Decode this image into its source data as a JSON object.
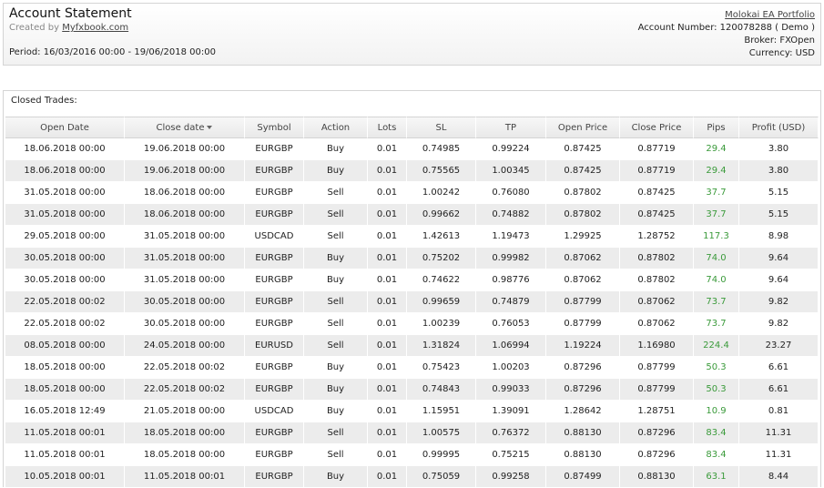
{
  "header": {
    "title": "Account Statement",
    "created_prefix": "Created by",
    "created_link": "Myfxbook.com",
    "period": "Period: 16/03/2016 00:00 - 19/06/2018 00:00",
    "portfolio_link": "Molokai EA Portfolio",
    "account_number": "Account Number: 120078288 ( Demo )",
    "broker": "Broker: FXOpen",
    "currency": "Currency: USD"
  },
  "closed_trades": {
    "label": "Closed Trades:",
    "sorted_column": "close_date",
    "columns": [
      "Open Date",
      "Close date",
      "Symbol",
      "Action",
      "Lots",
      "SL",
      "TP",
      "Open Price",
      "Close Price",
      "Pips",
      "Profit (USD)"
    ],
    "rows": [
      [
        "18.06.2018 00:00",
        "19.06.2018 00:00",
        "EURGBP",
        "Buy",
        "0.01",
        "0.74985",
        "0.99224",
        "0.87425",
        "0.87719",
        "29.4",
        "3.80"
      ],
      [
        "18.06.2018 00:00",
        "19.06.2018 00:00",
        "EURGBP",
        "Buy",
        "0.01",
        "0.75565",
        "1.00345",
        "0.87425",
        "0.87719",
        "29.4",
        "3.80"
      ],
      [
        "31.05.2018 00:00",
        "18.06.2018 00:00",
        "EURGBP",
        "Sell",
        "0.01",
        "1.00242",
        "0.76080",
        "0.87802",
        "0.87425",
        "37.7",
        "5.15"
      ],
      [
        "31.05.2018 00:00",
        "18.06.2018 00:00",
        "EURGBP",
        "Sell",
        "0.01",
        "0.99662",
        "0.74882",
        "0.87802",
        "0.87425",
        "37.7",
        "5.15"
      ],
      [
        "29.05.2018 00:00",
        "31.05.2018 00:00",
        "USDCAD",
        "Sell",
        "0.01",
        "1.42613",
        "1.19473",
        "1.29925",
        "1.28752",
        "117.3",
        "8.98"
      ],
      [
        "30.05.2018 00:00",
        "31.05.2018 00:00",
        "EURGBP",
        "Buy",
        "0.01",
        "0.75202",
        "0.99982",
        "0.87062",
        "0.87802",
        "74.0",
        "9.64"
      ],
      [
        "30.05.2018 00:00",
        "31.05.2018 00:00",
        "EURGBP",
        "Buy",
        "0.01",
        "0.74622",
        "0.98776",
        "0.87062",
        "0.87802",
        "74.0",
        "9.64"
      ],
      [
        "22.05.2018 00:02",
        "30.05.2018 00:00",
        "EURGBP",
        "Sell",
        "0.01",
        "0.99659",
        "0.74879",
        "0.87799",
        "0.87062",
        "73.7",
        "9.82"
      ],
      [
        "22.05.2018 00:02",
        "30.05.2018 00:00",
        "EURGBP",
        "Sell",
        "0.01",
        "1.00239",
        "0.76053",
        "0.87799",
        "0.87062",
        "73.7",
        "9.82"
      ],
      [
        "08.05.2018 00:00",
        "24.05.2018 00:00",
        "EURUSD",
        "Sell",
        "0.01",
        "1.31824",
        "1.06994",
        "1.19224",
        "1.16980",
        "224.4",
        "23.27"
      ],
      [
        "18.05.2018 00:00",
        "22.05.2018 00:02",
        "EURGBP",
        "Buy",
        "0.01",
        "0.75423",
        "1.00203",
        "0.87296",
        "0.87799",
        "50.3",
        "6.61"
      ],
      [
        "18.05.2018 00:00",
        "22.05.2018 00:02",
        "EURGBP",
        "Buy",
        "0.01",
        "0.74843",
        "0.99033",
        "0.87296",
        "0.87799",
        "50.3",
        "6.61"
      ],
      [
        "16.05.2018 12:49",
        "21.05.2018 00:00",
        "USDCAD",
        "Buy",
        "0.01",
        "1.15951",
        "1.39091",
        "1.28642",
        "1.28751",
        "10.9",
        "0.81"
      ],
      [
        "11.05.2018 00:01",
        "18.05.2018 00:00",
        "EURGBP",
        "Sell",
        "0.01",
        "1.00575",
        "0.76372",
        "0.88130",
        "0.87296",
        "83.4",
        "11.31"
      ],
      [
        "11.05.2018 00:01",
        "18.05.2018 00:00",
        "EURGBP",
        "Sell",
        "0.01",
        "0.99995",
        "0.75215",
        "0.88130",
        "0.87296",
        "83.4",
        "11.31"
      ],
      [
        "10.05.2018 00:01",
        "11.05.2018 00:01",
        "EURGBP",
        "Buy",
        "0.01",
        "0.75059",
        "0.99258",
        "0.87499",
        "0.88130",
        "63.1",
        "8.44"
      ]
    ]
  },
  "colors": {
    "pips_positive": "#3a9a3a",
    "row_alt": "#ececec",
    "header_bg": "#e9e9e9"
  }
}
